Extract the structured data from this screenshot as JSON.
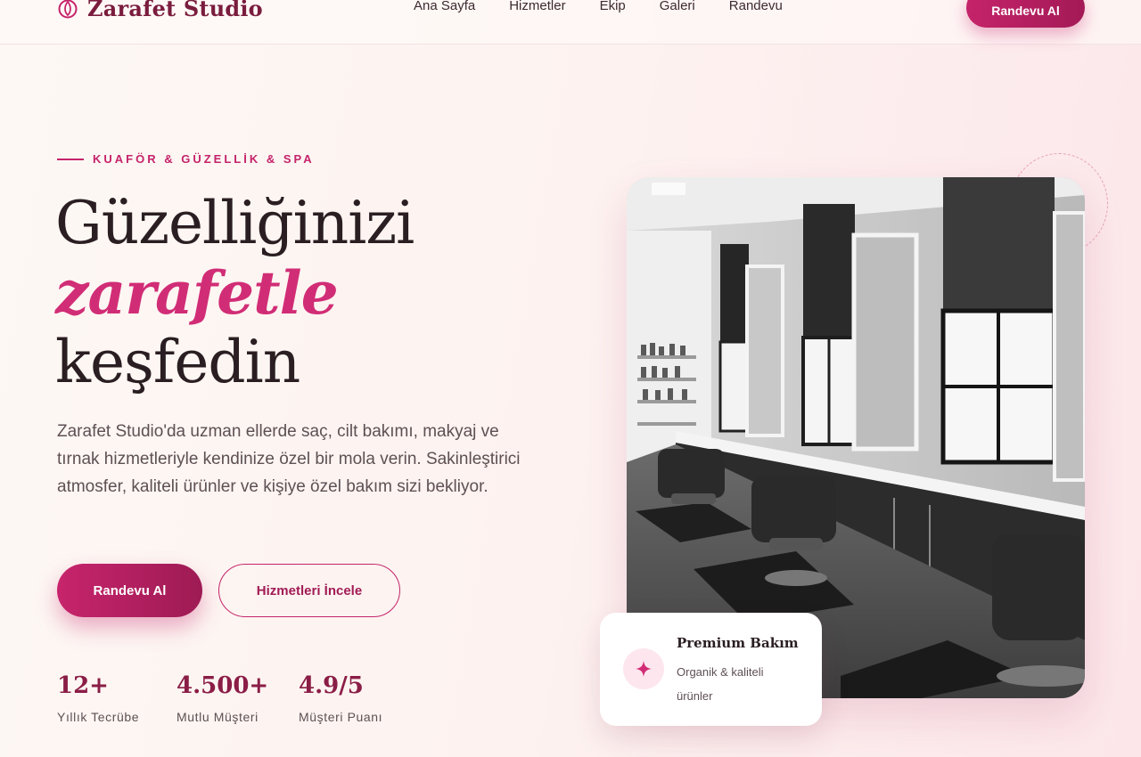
{
  "brand": {
    "name": "Zarafet Studio",
    "icon": "leaf-logo-icon",
    "accent": "#c5236a",
    "dark_accent": "#8a1d46"
  },
  "nav": {
    "items": [
      {
        "label": "Ana Sayfa"
      },
      {
        "label": "Hizmetler"
      },
      {
        "label": "Ekip"
      },
      {
        "label": "Galeri"
      },
      {
        "label": "Randevu"
      }
    ],
    "cta_label": "Randevu Al"
  },
  "hero": {
    "eyebrow": "KUAFÖR & GÜZELLİK & SPA",
    "title_line1": "Güzelliğinizi",
    "title_highlight": "zarafetle",
    "title_line3": "keşfedin",
    "description": "Zarafet Studio'da uzman ellerde saç, cilt bakımı, makyaj ve tırnak hizmetleriyle kendinize özel bir mola verin. Sakinleştirici atmosfer, kaliteli ürünler ve kişiye özel bakım sizi bekliyor.",
    "primary_button": "Randevu Al",
    "secondary_button": "Hizmetleri İncele",
    "stats": [
      {
        "value": "12+",
        "label": "Yıllık Tecrübe"
      },
      {
        "value": "4.500+",
        "label": "Mutlu Müşteri"
      },
      {
        "value": "4.9/5",
        "label": "Müşteri Puanı"
      }
    ]
  },
  "feature_card": {
    "icon": "sparkle-icon",
    "title": "Premium Bakım",
    "subtitle": "Organik & kaliteli ürünler"
  }
}
